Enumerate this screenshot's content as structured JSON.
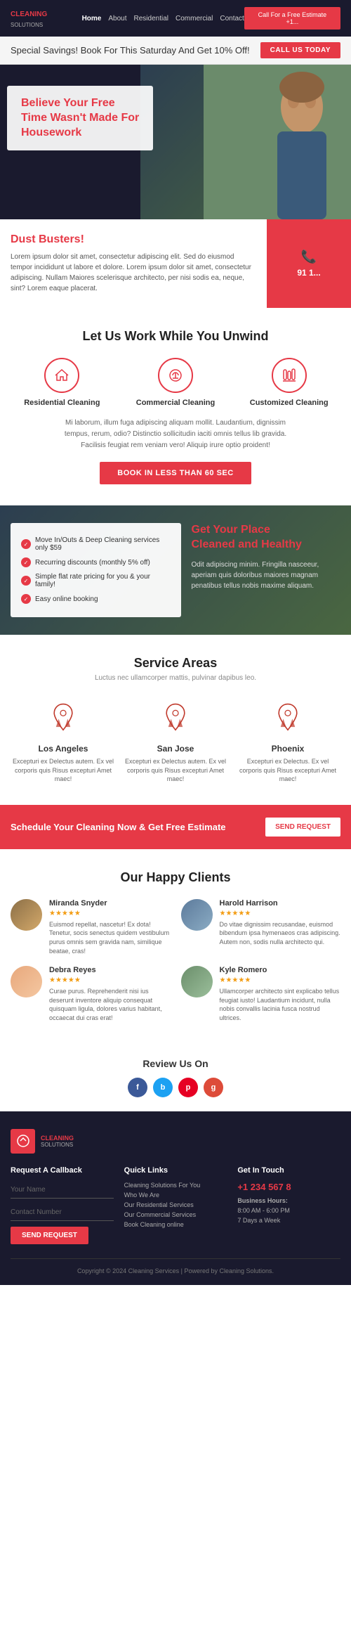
{
  "nav": {
    "logo_line1": "CLEANING",
    "logo_line2": "SOLUTIONS",
    "links": [
      "Home",
      "About",
      "Residential",
      "Commercial",
      "Contact"
    ],
    "active_link": "Home",
    "cta": "Call For a Free Estimate +1..."
  },
  "banner": {
    "text": "Special Savings! Book For This Saturday And Get 10% Off!",
    "btn": "CALL US TODAY"
  },
  "hero": {
    "heading_line1": "Believe Your Free",
    "heading_line2": "Time Wasn't Made For",
    "heading_line3": "Housework"
  },
  "dust": {
    "heading": "Dust Busters!",
    "body": "Lorem ipsum dolor sit amet, consectetur adipiscing elit. Sed do eiusmod tempor incididunt ut labore et dolore. Lorem ipsum dolor sit amet, consectetur adipiscing. Nullam Maiores scelerisque architecto, per nisi sodis ea, neque, sint? Lorem eaque placerat.",
    "phone_icon": "📞",
    "phone_number": "91 1..."
  },
  "work": {
    "heading": "Let Us Work While You Unwind",
    "services": [
      {
        "label": "Residential Cleaning",
        "icon": "broom"
      },
      {
        "label": "Commercial Cleaning",
        "icon": "vacuum"
      },
      {
        "label": "Customized Cleaning",
        "icon": "bottles"
      }
    ],
    "description": "Mi laborum, illum fuga adipiscing aliquam mollit. Laudantium, dignissim tempus, rerum, odio? Distinctio sollicitudin iaciti omnis tellus lib gravida. Facilisis feugiat rem veniam vero! Aliquip irure optio proident!",
    "book_btn": "BOOK IN LESS THAN 60 SEC"
  },
  "cleaned": {
    "list": [
      "Move In/Outs & Deep Cleaning services only $59",
      "Recurring discounts (monthly 5% off)",
      "Simple flat rate pricing for you & your family!",
      "Easy online booking"
    ],
    "heading_line1": "Get Your Place",
    "heading_line2": "Cleaned and Healthy",
    "body": "Odit adipiscing minim. Fringilla nasceeur, aperiam quis doloribus maiores magnam penatibus tellus nobis maxime aliquam."
  },
  "service_areas": {
    "heading": "Service Areas",
    "subtitle": "Luctus nec ullamcorper mattis, pulvinar dapibus leo.",
    "areas": [
      {
        "name": "Los Angeles",
        "desc": "Excepturi ex Delectus autem. Ex vel corporis quis Risus excepturi Amet maec!"
      },
      {
        "name": "San Jose",
        "desc": "Excepturi ex Delectus autem. Ex vel corporis quis Risus excepturi Amet maec!"
      },
      {
        "name": "Phoenix",
        "desc": "Excepturi ex Delectus. Ex vel corporis quis Risus excepturi Amet maec!"
      }
    ]
  },
  "schedule": {
    "text": "Schedule Your Cleaning Now & Get Free Estimate",
    "btn": "SEND REQUEST"
  },
  "clients": {
    "heading": "Our Happy Clients",
    "list": [
      {
        "name": "Miranda Snyder",
        "stars": 5,
        "text": "Euismod repellat, nascetur! Ex dota! Tenetur, socis senectus quidem vestibulum purus omnis sem gravida nam, similique beatae, cras!"
      },
      {
        "name": "Harold Harrison",
        "stars": 5,
        "text": "Do vitae dignissim recusandae, euismod bibendum ipsa hymenaeos cras adipiscing. Autem non, sodis nulla architecto qui."
      },
      {
        "name": "Debra Reyes",
        "stars": 5,
        "text": "Curae purus. Reprehenderit nisi ius deserunt inventore aliquip consequat quisquam ligula, dolores varius habitant, occaecat dui cras erat!"
      },
      {
        "name": "Kyle Romero",
        "stars": 5,
        "text": "Ullamcorper architecto sint explicabo tellus feugiat iusto! Laudantium incidunt, nulla nobis convallis lacinia fusca nostrud ultrices."
      }
    ]
  },
  "review": {
    "heading": "Review Us On",
    "socials": [
      "f",
      "b",
      "p",
      "g"
    ]
  },
  "footer": {
    "logo_text": "CLEANING SOLUTIONS",
    "callback_heading": "Request A Callback",
    "name_placeholder": "Your Name",
    "contact_placeholder": "Contact Number",
    "send_btn": "SEND REQUEST",
    "quick_links_heading": "Quick Links",
    "links": [
      "Cleaning Solutions For You",
      "Who We Are",
      "Our Residential Services",
      "Our Commercial Services",
      "Book Cleaning online"
    ],
    "get_in_touch_heading": "Get In Touch",
    "phone": "+1 234 567 8",
    "hours_label": "Business Hours:",
    "hours": "8:00 AM - 6:00 PM",
    "days": "7 Days a Week",
    "copyright": "Copyright © 2024 Cleaning Services | Powered by Cleaning Solutions."
  }
}
